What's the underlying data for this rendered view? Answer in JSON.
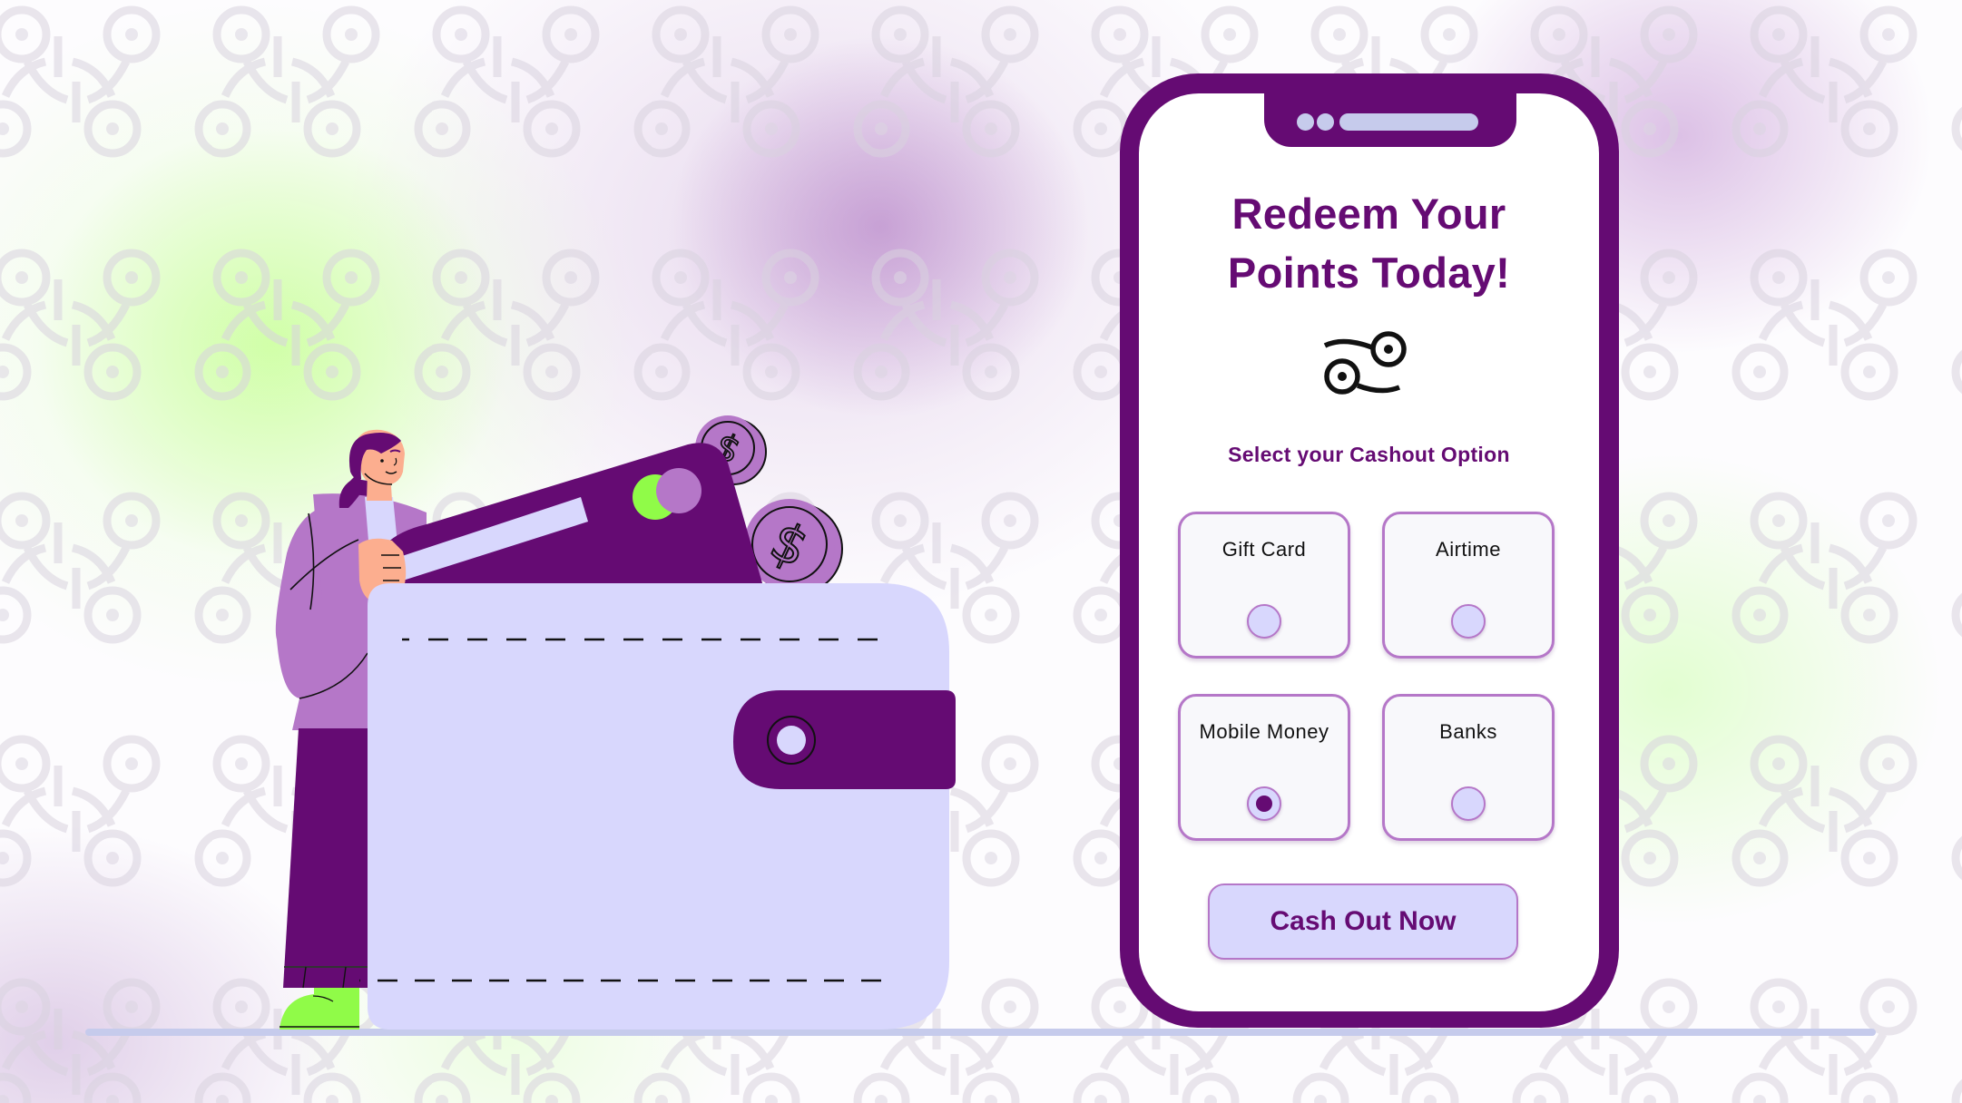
{
  "colors": {
    "brand_purple": "#650b73",
    "light_purple": "#b577c8",
    "lavender": "#d8d7fd",
    "accent_green": "#90fb48",
    "ground": "#c6cbec"
  },
  "illustration": {
    "subject": "woman inserting credit card into wallet with dollar coins",
    "coin_symbol": "$"
  },
  "phone": {
    "title_line1": "Redeem Your",
    "title_line2": "Points Today!",
    "logo_icon": "brand-logo-icon",
    "subtitle": "Select your Cashout Option",
    "options": [
      {
        "label": "Gift Card",
        "selected": false
      },
      {
        "label": "Airtime",
        "selected": false
      },
      {
        "label": "Mobile Money",
        "selected": true
      },
      {
        "label": "Banks",
        "selected": false
      }
    ],
    "cta_label": "Cash Out Now"
  }
}
